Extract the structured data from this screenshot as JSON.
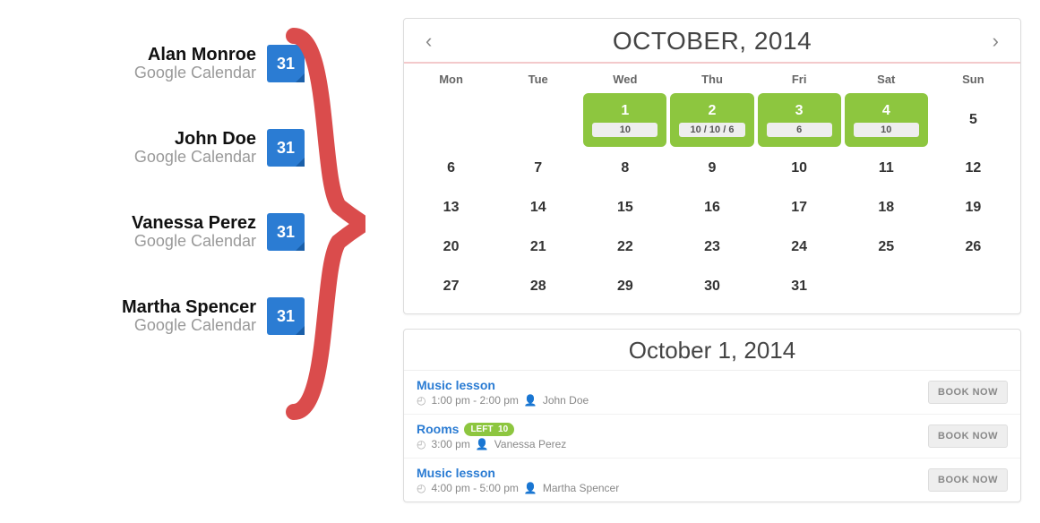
{
  "people": [
    {
      "name": "Alan Monroe",
      "sub": "Google Calendar"
    },
    {
      "name": "John Doe",
      "sub": "Google Calendar"
    },
    {
      "name": "Vanessa Perez",
      "sub": "Google Calendar"
    },
    {
      "name": "Martha Spencer",
      "sub": "Google Calendar"
    }
  ],
  "calendar": {
    "title": "OCTOBER, 2014",
    "dow": [
      "Mon",
      "Tue",
      "Wed",
      "Thu",
      "Fri",
      "Sat",
      "Sun"
    ],
    "leading_blanks": 2,
    "days_in_month": 31,
    "highlights": {
      "1": "10",
      "2": "10 / 10 / 6",
      "3": "6",
      "4": "10"
    }
  },
  "details": {
    "title": "October 1, 2014",
    "events": [
      {
        "title": "Music lesson",
        "time": "1:00 pm - 2:00 pm",
        "person": "John Doe",
        "left": null
      },
      {
        "title": "Rooms",
        "time": "3:00 pm",
        "person": "Vanessa Perez",
        "left": "10"
      },
      {
        "title": "Music lesson",
        "time": "4:00 pm - 5:00 pm",
        "person": "Martha Spencer",
        "left": null
      }
    ],
    "book_label": "BOOK NOW",
    "left_label": "LEFT"
  }
}
